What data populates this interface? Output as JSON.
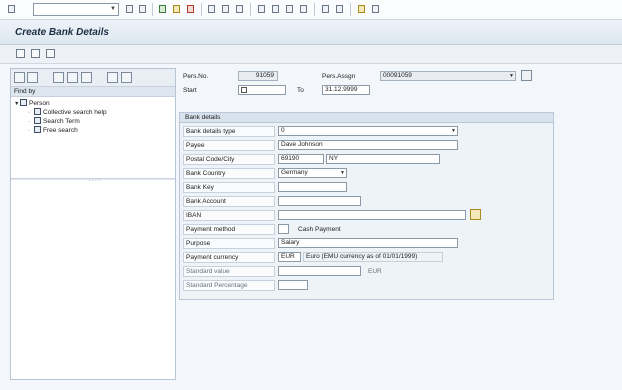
{
  "app": {
    "title": "Create Bank Details"
  },
  "navigator": {
    "find_by_label": "Find by",
    "tree": {
      "root": "Person",
      "items": [
        "Collective search help",
        "Search Term",
        "Free search"
      ]
    }
  },
  "header": {
    "pers_no_label": "Pers.No.",
    "pers_no_value": "91059",
    "pers_assign_label": "Pers.Assgn",
    "pers_assign_value": "00091059",
    "start_label": "Start",
    "to_label": "To",
    "to_value": "31.12.9999"
  },
  "bank_details": {
    "group_title": "Bank details",
    "type_label": "Bank details type",
    "type_value": "0",
    "payee_label": "Payee",
    "payee_value": "Dave Johnson",
    "postal_label": "Postal Code/City",
    "postal_code": "69190",
    "city": "NY",
    "country_label": "Bank Country",
    "country_value": "Germany",
    "bank_key_label": "Bank Key",
    "bank_key_value": "",
    "account_label": "Bank Account",
    "account_value": "",
    "iban_label": "IBAN",
    "iban_value": "",
    "payment_method_label": "Payment method",
    "payment_method_value": "",
    "payment_method_text": "Cash Payment",
    "purpose_label": "Purpose",
    "purpose_value": "Salary",
    "currency_label": "Payment currency",
    "currency_value": "EUR",
    "currency_text": "Euro (EMU currency as of 01/01/1999)",
    "standard_value_label": "Standard value",
    "standard_value_value": "",
    "standard_value_unit": "EUR",
    "standard_percentage_label": "Standard Percentage",
    "standard_percentage_value": ""
  }
}
